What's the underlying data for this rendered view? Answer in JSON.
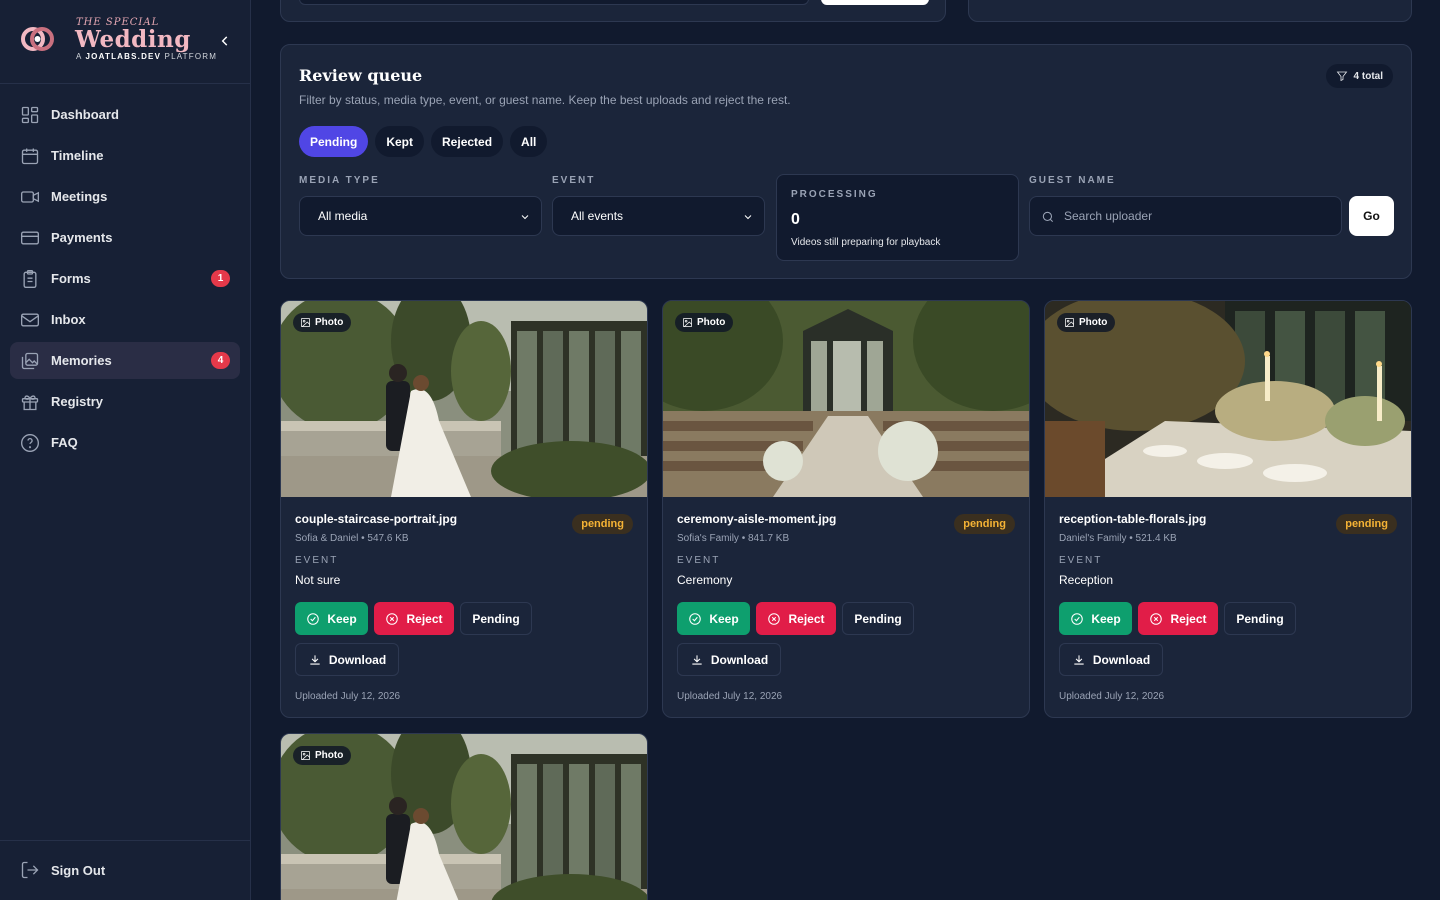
{
  "brand": {
    "pre": "THE SPECIAL",
    "title": "Wedding",
    "sub_prefix": "A ",
    "sub_strong": "JOATLABS.DEV",
    "sub_suffix": " PLATFORM"
  },
  "nav": [
    {
      "label": "Dashboard",
      "icon": "grid-icon"
    },
    {
      "label": "Timeline",
      "icon": "calendar-icon"
    },
    {
      "label": "Meetings",
      "icon": "video-icon"
    },
    {
      "label": "Payments",
      "icon": "credit-card-icon"
    },
    {
      "label": "Forms",
      "icon": "clipboard-icon",
      "badge": "1"
    },
    {
      "label": "Inbox",
      "icon": "mail-icon"
    },
    {
      "label": "Memories",
      "icon": "images-icon",
      "badge": "4",
      "active": true
    },
    {
      "label": "Registry",
      "icon": "gift-icon"
    },
    {
      "label": "FAQ",
      "icon": "help-circle-icon"
    }
  ],
  "sign_out": "Sign Out",
  "review": {
    "title": "Review queue",
    "description": "Filter by status, media type, event, or guest name. Keep the best uploads and reject the rest.",
    "total": "4 total",
    "tabs": [
      "Pending",
      "Kept",
      "Rejected",
      "All"
    ],
    "active_tab": "Pending",
    "media_type_label": "MEDIA TYPE",
    "media_type_value": "All media",
    "event_label": "EVENT",
    "event_value": "All events",
    "processing_label": "PROCESSING",
    "processing_value": "0",
    "processing_note": "Videos still preparing for playback",
    "guest_label": "GUEST NAME",
    "guest_placeholder": "Search uploader",
    "go_label": "Go"
  },
  "cards": [
    {
      "media": "Photo",
      "file": "couple-staircase-portrait.jpg",
      "status": "pending",
      "meta": "Sofia & Daniel • 547.6 KB",
      "event_label": "EVENT",
      "event": "Not sure",
      "keep": "Keep",
      "reject": "Reject",
      "pending": "Pending",
      "download": "Download",
      "uploaded": "Uploaded July 12, 2026"
    },
    {
      "media": "Photo",
      "file": "ceremony-aisle-moment.jpg",
      "status": "pending",
      "meta": "Sofia's Family • 841.7 KB",
      "event_label": "EVENT",
      "event": "Ceremony",
      "keep": "Keep",
      "reject": "Reject",
      "pending": "Pending",
      "download": "Download",
      "uploaded": "Uploaded July 12, 2026"
    },
    {
      "media": "Photo",
      "file": "reception-table-florals.jpg",
      "status": "pending",
      "meta": "Daniel's Family • 521.4 KB",
      "event_label": "EVENT",
      "event": "Reception",
      "keep": "Keep",
      "reject": "Reject",
      "pending": "Pending",
      "download": "Download",
      "uploaded": "Uploaded July 12, 2026"
    },
    {
      "media": "Photo"
    }
  ],
  "colors": {
    "accent": "#5046e5",
    "keep": "#0e9f6e",
    "reject": "#e11d48",
    "pending_badge": "#f5b335",
    "brand": "#f2b8c2"
  }
}
